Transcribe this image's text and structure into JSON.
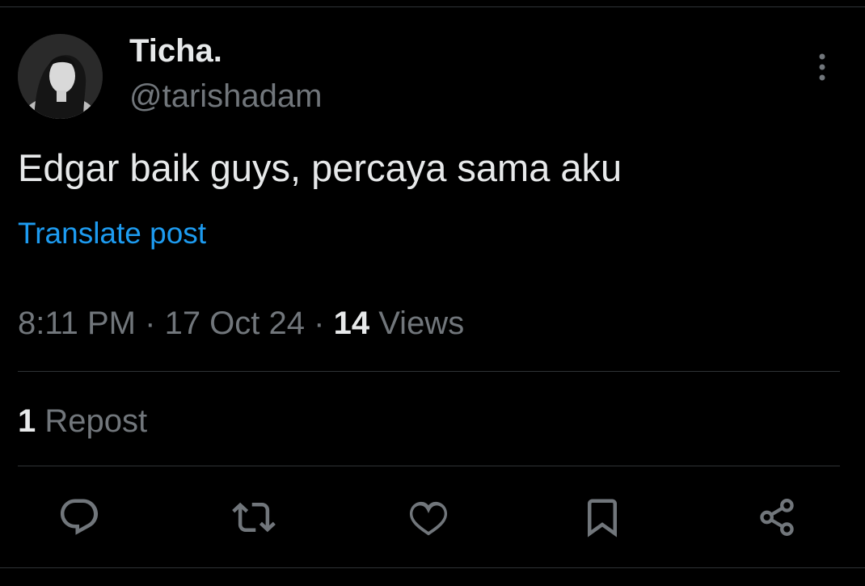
{
  "author": {
    "display_name": "Ticha.",
    "handle": "@tarishadam"
  },
  "tweet": {
    "text": "Edgar baik guys, percaya sama aku",
    "translate_label": "Translate post",
    "time": "8:11 PM",
    "separator": "·",
    "date": "17 Oct 24",
    "views_count": "14",
    "views_label": "Views"
  },
  "stats": {
    "reposts_count": "1",
    "reposts_label": "Repost"
  },
  "actions": {
    "icons": [
      "reply-icon",
      "repost-icon",
      "like-icon",
      "bookmark-icon",
      "share-icon"
    ]
  },
  "colors": {
    "background": "#000000",
    "primary_text": "#e7e9ea",
    "secondary_text": "#71767b",
    "link": "#1d9bf0",
    "divider": "#2f3336"
  }
}
